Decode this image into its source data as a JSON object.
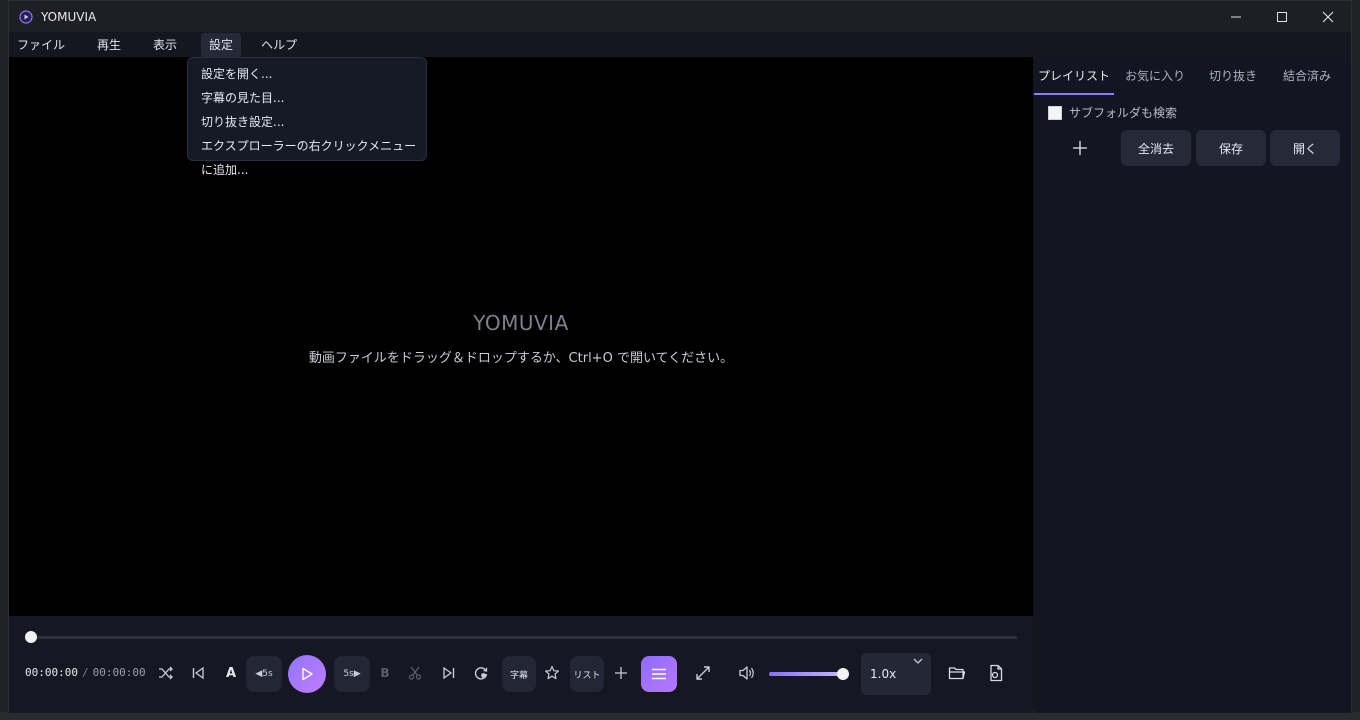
{
  "window": {
    "title": "YOMUVIA"
  },
  "menu": {
    "items": [
      "ファイル",
      "再生",
      "表示",
      "設定",
      "ヘルプ"
    ],
    "open_menu": "設定",
    "dropdown": [
      "設定を開く...",
      "字幕の見た目...",
      "切り抜き設定...",
      "エクスプローラーの右クリックメニューに追加..."
    ]
  },
  "video": {
    "brand": "YOMUVIA",
    "hint": "動画ファイルをドラッグ＆ドロップするか、Ctrl+O で開いてください。"
  },
  "controls": {
    "current_time": "00:00:00",
    "separator": "/",
    "total_time": "00:00:00",
    "seek_progress": 0,
    "back5_label": "◀5s",
    "fwd5_label": "5s▶",
    "a_label": "A",
    "b_label": "B",
    "subtitle_label": "字幕",
    "list_label": "リスト",
    "volume": 1.0,
    "speed": "1.0x"
  },
  "sidebar": {
    "tabs": [
      "プレイリスト",
      "お気に入り",
      "切り抜き",
      "結合済み"
    ],
    "active_tab": 0,
    "subfolder_label": "サブフォルダも検索",
    "subfolder_checked": false,
    "clear_all_label": "全消去",
    "save_label": "保存",
    "open_label": "開く"
  },
  "colors": {
    "accent": "#8f76ff",
    "video_bg": "#000000",
    "panel_bg": "#131620"
  }
}
